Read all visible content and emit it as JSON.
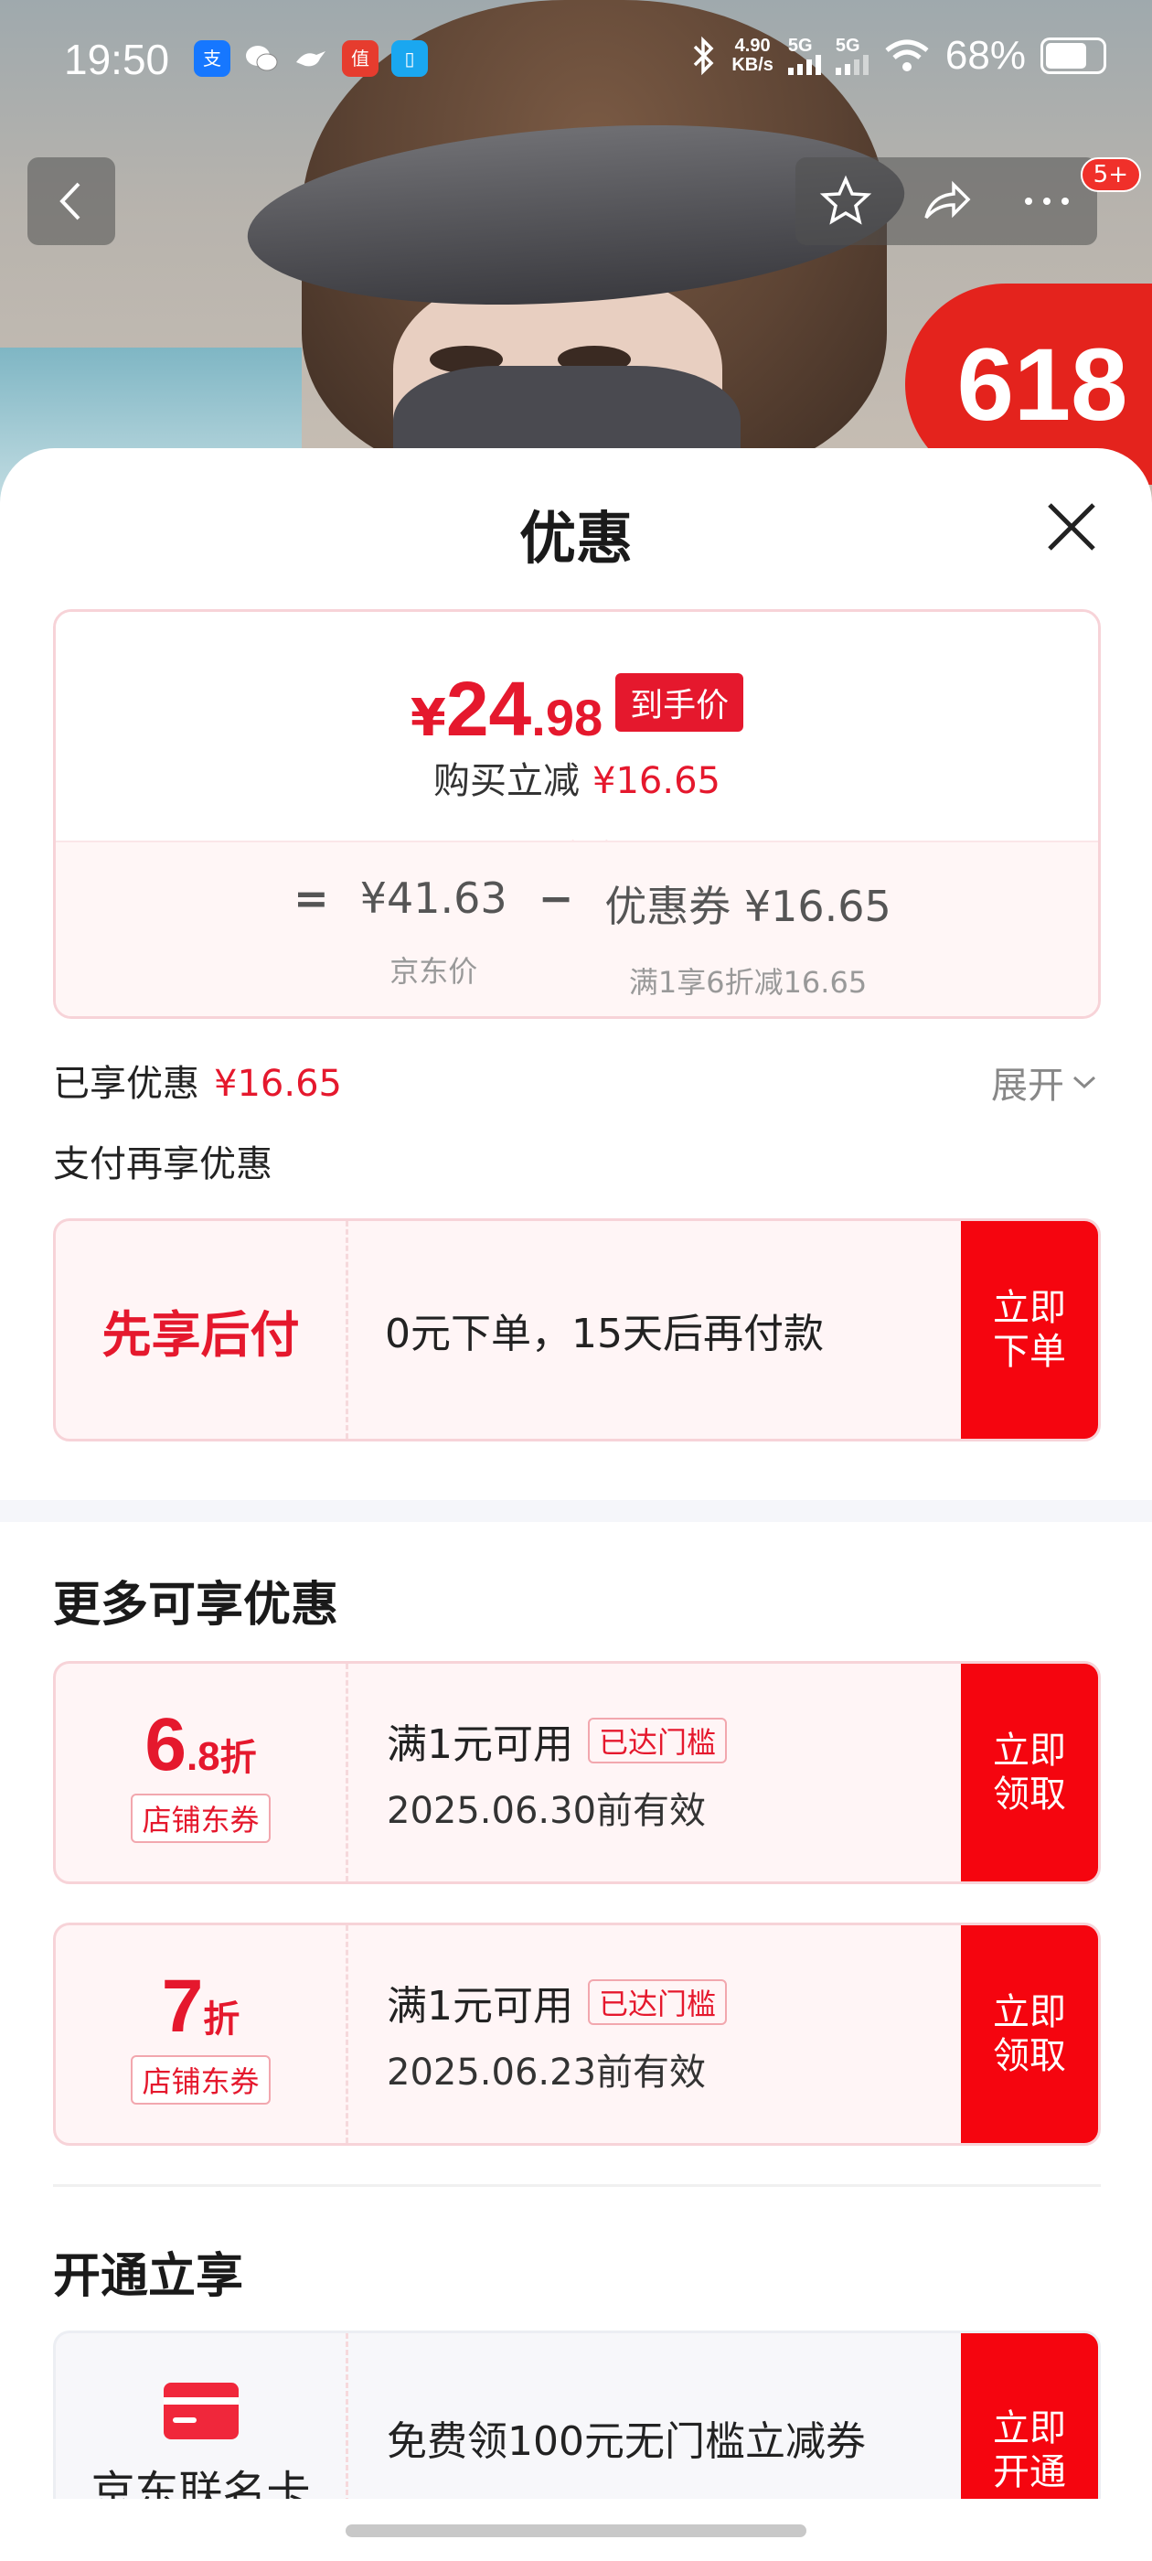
{
  "status_bar": {
    "time": "19:50",
    "net_speed_value": "4.90",
    "net_speed_unit": "KB/s",
    "sig1": "5G",
    "sig2": "5G",
    "battery": "68%"
  },
  "product_image": {
    "promo_badge": "618",
    "more_badge": "5+"
  },
  "sheet": {
    "title": "优惠",
    "final_price": {
      "yen": "¥",
      "int": "24",
      "dec": ".98",
      "tag": "到手价"
    },
    "reduce": {
      "label": "购买立减",
      "value": "¥16.65"
    },
    "formula": {
      "eq": "=",
      "jd_price": "¥41.63",
      "jd_price_label": "京东价",
      "minus": "−",
      "coupon": "优惠券 ¥16.65",
      "coupon_desc": "满1享6折减16.65"
    },
    "enjoyed": {
      "label": "已享优惠",
      "value": "¥16.65",
      "expand": "展开"
    },
    "pay_section_label": "支付再享优惠",
    "pay_card": {
      "title": "先享后付",
      "desc": "0元下单，15天后再付款",
      "action": "立即下单"
    },
    "more_section_title": "更多可享优惠",
    "coupons": [
      {
        "num": "6",
        "dec": ".8",
        "unit": "折",
        "tag": "店铺东券",
        "condition": "满1元可用",
        "reached": "已达门槛",
        "valid": "2025.06.30前有效",
        "action": "立即领取"
      },
      {
        "num": "7",
        "dec": "",
        "unit": "折",
        "tag": "店铺东券",
        "condition": "满1元可用",
        "reached": "已达门槛",
        "valid": "2025.06.23前有效",
        "action": "立即领取"
      }
    ],
    "open_section_title": "开通立享",
    "open_card": {
      "title": "京东联名卡",
      "desc": "免费领100元无门槛立减券",
      "action": "立即开通"
    }
  },
  "colors": {
    "accent_red": "#e5182d",
    "button_red": "#f5050f"
  }
}
